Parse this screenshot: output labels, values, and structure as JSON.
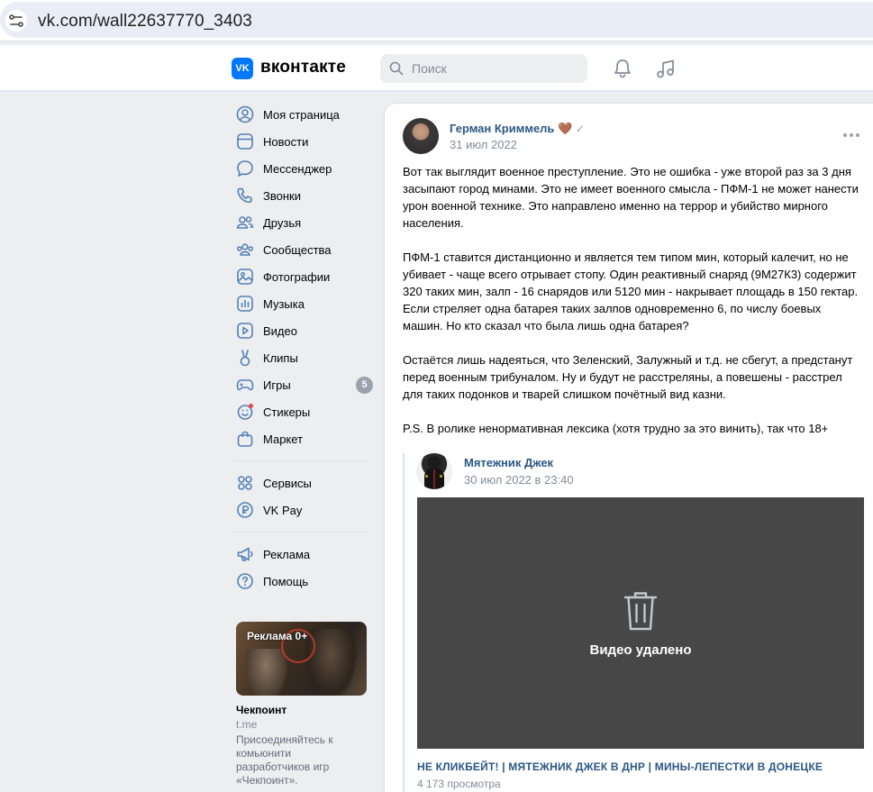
{
  "browser": {
    "url": "vk.com/wall22637770_3403",
    "icon": "tune-icon"
  },
  "header": {
    "logo_mark": "VK",
    "logo_text": "вконтакте",
    "search_placeholder": "Поиск",
    "icons": [
      "search-icon",
      "bell-icon",
      "music-icon"
    ]
  },
  "sidebar": {
    "items": [
      {
        "label": "Моя страница",
        "icon": "profile-icon"
      },
      {
        "label": "Новости",
        "icon": "news-icon"
      },
      {
        "label": "Мессенджер",
        "icon": "messenger-icon"
      },
      {
        "label": "Звонки",
        "icon": "phone-icon"
      },
      {
        "label": "Друзья",
        "icon": "friends-icon"
      },
      {
        "label": "Сообщества",
        "icon": "communities-icon"
      },
      {
        "label": "Фотографии",
        "icon": "photos-icon"
      },
      {
        "label": "Музыка",
        "icon": "music-icon"
      },
      {
        "label": "Видео",
        "icon": "video-icon"
      },
      {
        "label": "Клипы",
        "icon": "clips-icon"
      },
      {
        "label": "Игры",
        "icon": "games-icon",
        "badge": "5"
      },
      {
        "label": "Стикеры",
        "icon": "stickers-icon"
      },
      {
        "label": "Маркет",
        "icon": "market-icon"
      },
      {
        "label": "Сервисы",
        "icon": "services-icon"
      },
      {
        "label": "VK Pay",
        "icon": "vkpay-icon"
      },
      {
        "label": "Реклама",
        "icon": "megaphone-icon"
      },
      {
        "label": "Помощь",
        "icon": "help-icon"
      }
    ],
    "ad": {
      "badge": "Реклама 0+",
      "title": "Чекпоинт",
      "domain": "t.me",
      "description": "Присоединяйтесь к комьюнити разработчиков игр «Чекпоинт»."
    }
  },
  "post": {
    "author": "Герман Криммель",
    "author_badge": "🤎",
    "verified_mark": "✓",
    "date": "31 июл 2022",
    "paragraphs": [
      "Вот так выглядит военное преступление. Это не ошибка - уже второй раз за 3 дня засыпают город минами. Это не имеет военного смысла - ПФМ-1 не может нанести урон военной технике. Это направлено именно на террор и убийство мирного населения.",
      "ПФМ-1 ставится дистанционно и является тем типом мин, который калечит, но не убивает - чаще всего отрывает стопу. Один реактивный снаряд (9М27К3) содержит 320 таких мин, залп - 16 снарядов или 5120 мин - накрывает площадь в 150 гектар. Если стреляет одна батарея таких залпов одновременно 6, по числу боевых машин. Но кто сказал что была лишь одна батарея?",
      "Остаётся лишь надеяться, что Зеленский, Залужный и т.д. не сбегут, а предстанут перед военным трибуналом. Ну и будут не расстреляны, а повешены - расстрел для таких подонков и тварей слишком почётный вид казни.",
      "P.S. В ролике ненормативная лексика (хотя трудно за это винить), так что 18+"
    ],
    "repost": {
      "author": "Мятежник Джек",
      "date": "30 июл 2022 в 23:40",
      "video_status": "Видео удалено",
      "video_title": "НЕ КЛИКБЕЙТ! | МЯТЕЖНИК ДЖЕК В ДНР | МИНЫ-ЛЕПЕСТКИ В ДОНЕЦКЕ",
      "views": "4 173 просмотра"
    }
  },
  "colors": {
    "brand": "#0077ff",
    "link": "#2a5885",
    "muted": "#818c99",
    "badge": "#99a2ad",
    "page_bg": "#edeef0",
    "video_bg": "#474747"
  }
}
